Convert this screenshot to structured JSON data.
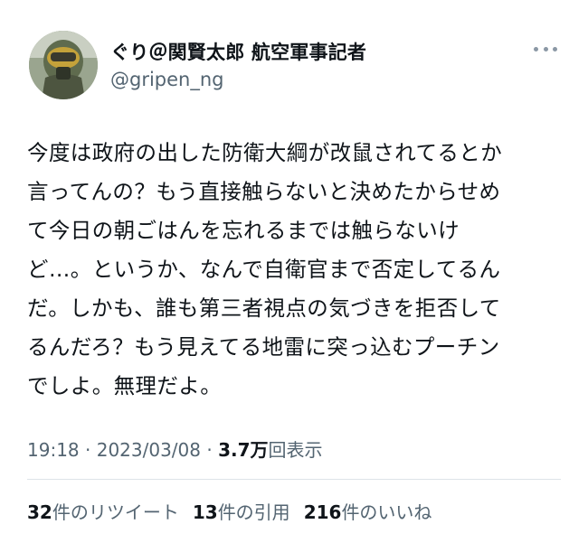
{
  "author": {
    "display_name": "ぐり＠関賢太郎 航空軍事記者",
    "handle": "@gripen_ng",
    "avatar_icon": "pilot-helmet-avatar"
  },
  "menu": {
    "icon": "more-horizontal-icon"
  },
  "tweet": {
    "lines": [
      "今度は政府の出した防衛大綱が改鼠されてるとか",
      "言ってんの？もう直接触らないと決めたからせめ",
      "て今日の朝ごはんを忘れるまでは触らないけ",
      "ど…。というか、なんで自衛官まで否定してるん",
      "だ。しかも、誰も第三者視点の気づきを拒否して",
      "るんだろ？もう見えてる地雷に突っ込むプーチン",
      "でしよ。無理だよ。"
    ]
  },
  "meta": {
    "time": "19:18",
    "separator": " · ",
    "date": "2023/03/08",
    "views_value": "3.7万",
    "views_label": "回表示"
  },
  "stats": {
    "retweets_count": "32",
    "retweets_label": "件のリツイート",
    "quotes_count": "13",
    "quotes_label": "件の引用",
    "likes_count": "216",
    "likes_label": "件のいいね"
  },
  "colors": {
    "text": "#0f1419",
    "secondary": "#536471",
    "divider": "#dde3e8"
  }
}
